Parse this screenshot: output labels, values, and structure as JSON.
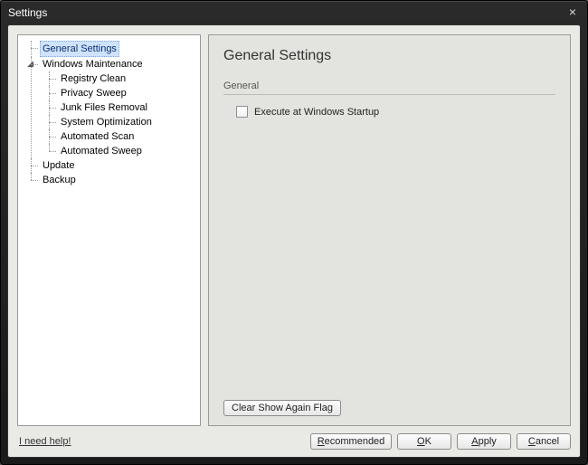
{
  "window": {
    "title": "Settings",
    "close_glyph": "×"
  },
  "tree": {
    "general_settings": "General Settings",
    "windows_maintenance": "Windows Maintenance",
    "wm_children": {
      "registry_clean": "Registry Clean",
      "privacy_sweep": "Privacy Sweep",
      "junk_files_removal": "Junk Files Removal",
      "system_optimization": "System Optimization",
      "automated_scan": "Automated Scan",
      "automated_sweep": "Automated Sweep"
    },
    "update": "Update",
    "backup": "Backup",
    "expander_glyph": "◢"
  },
  "content": {
    "heading": "General Settings",
    "section": "General",
    "execute_startup_label": "Execute at Windows Startup",
    "clear_flag_button": "Clear Show Again Flag"
  },
  "footer": {
    "help": "I need help!",
    "recommended_pre": "R",
    "recommended_post": "ecommended",
    "ok_pre": "O",
    "ok_post": "K",
    "apply_pre": "A",
    "apply_post": "pply",
    "cancel_pre": "C",
    "cancel_post": "ancel"
  }
}
